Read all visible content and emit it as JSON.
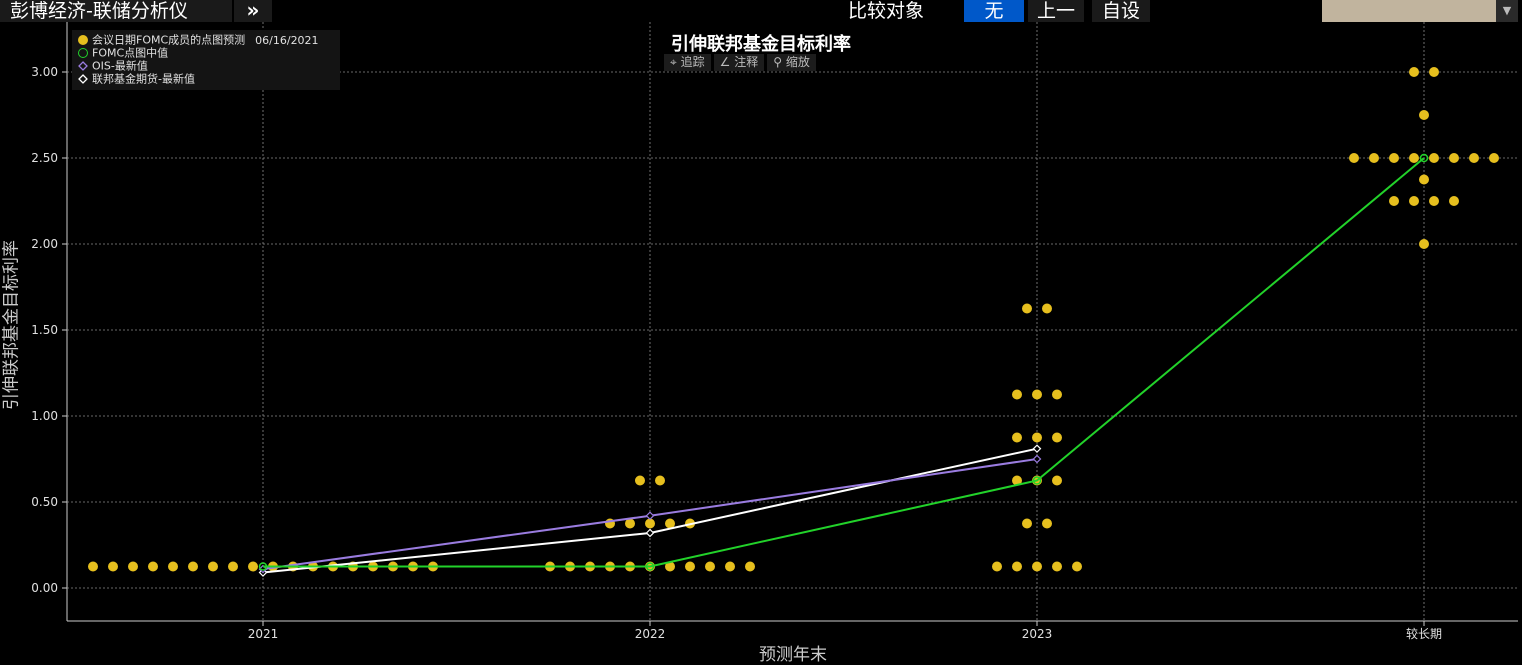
{
  "header": {
    "app_title": "彭博经济-联储分析仪",
    "more_icon": "double-chevron-right-icon",
    "compare_label": "比较对象",
    "compare_none": "无",
    "compare_prev": "上一",
    "compare_custom": "自设",
    "dropdown_value": "",
    "dropdown_icon": "caret-down-icon"
  },
  "toolbar": {
    "track_label": "追踪",
    "annotate_label": "注释",
    "zoom_label": "缩放"
  },
  "colors": {
    "dots": "#e6bf1e",
    "median": "#22d22a",
    "ois": "#9a7ce0",
    "futures": "#ffffff",
    "accent_blue": "#0058c9"
  },
  "chart_data": {
    "type": "scatter",
    "title": "引伸联邦基金目标利率",
    "xlabel": "预测年末",
    "ylabel": "引伸联邦基金目标利率",
    "categories": [
      "2021",
      "2022",
      "2023",
      "较长期"
    ],
    "ylim": [
      -0.2,
      3.3
    ],
    "yticks": [
      "0.00",
      "0.50",
      "1.00",
      "1.50",
      "2.00",
      "2.50",
      "3.00"
    ],
    "grid": true,
    "legend_position": "top-left",
    "legend": {
      "dots_label": "会议日期FOMC成员的点图预测",
      "dots_date": "06/16/2021",
      "median_label": "FOMC点图中值",
      "ois_label": "OIS-最新值",
      "futures_label": "联邦基金期货-最新值"
    },
    "dot_plot": [
      {
        "category": "2021",
        "rates": [
          0.125
        ],
        "counts": [
          18
        ]
      },
      {
        "category": "2022",
        "rates": [
          0.125,
          0.375,
          0.625
        ],
        "counts": [
          11,
          5,
          2
        ]
      },
      {
        "category": "2023",
        "rates": [
          0.125,
          0.375,
          0.625,
          0.875,
          1.125,
          1.625
        ],
        "counts": [
          5,
          2,
          3,
          3,
          3,
          2
        ]
      },
      {
        "category": "较长期",
        "rates": [
          2.0,
          2.25,
          2.375,
          2.5,
          2.75,
          3.0
        ],
        "counts": [
          1,
          4,
          1,
          8,
          1,
          2
        ]
      }
    ],
    "series": [
      {
        "name": "FOMC点图中值",
        "values": [
          0.125,
          0.125,
          0.625,
          2.5
        ]
      },
      {
        "name": "OIS-最新值",
        "values": [
          0.11,
          0.42,
          0.75,
          null
        ]
      },
      {
        "name": "联邦基金期货-最新值",
        "values": [
          0.09,
          0.32,
          0.81,
          null
        ]
      }
    ]
  }
}
